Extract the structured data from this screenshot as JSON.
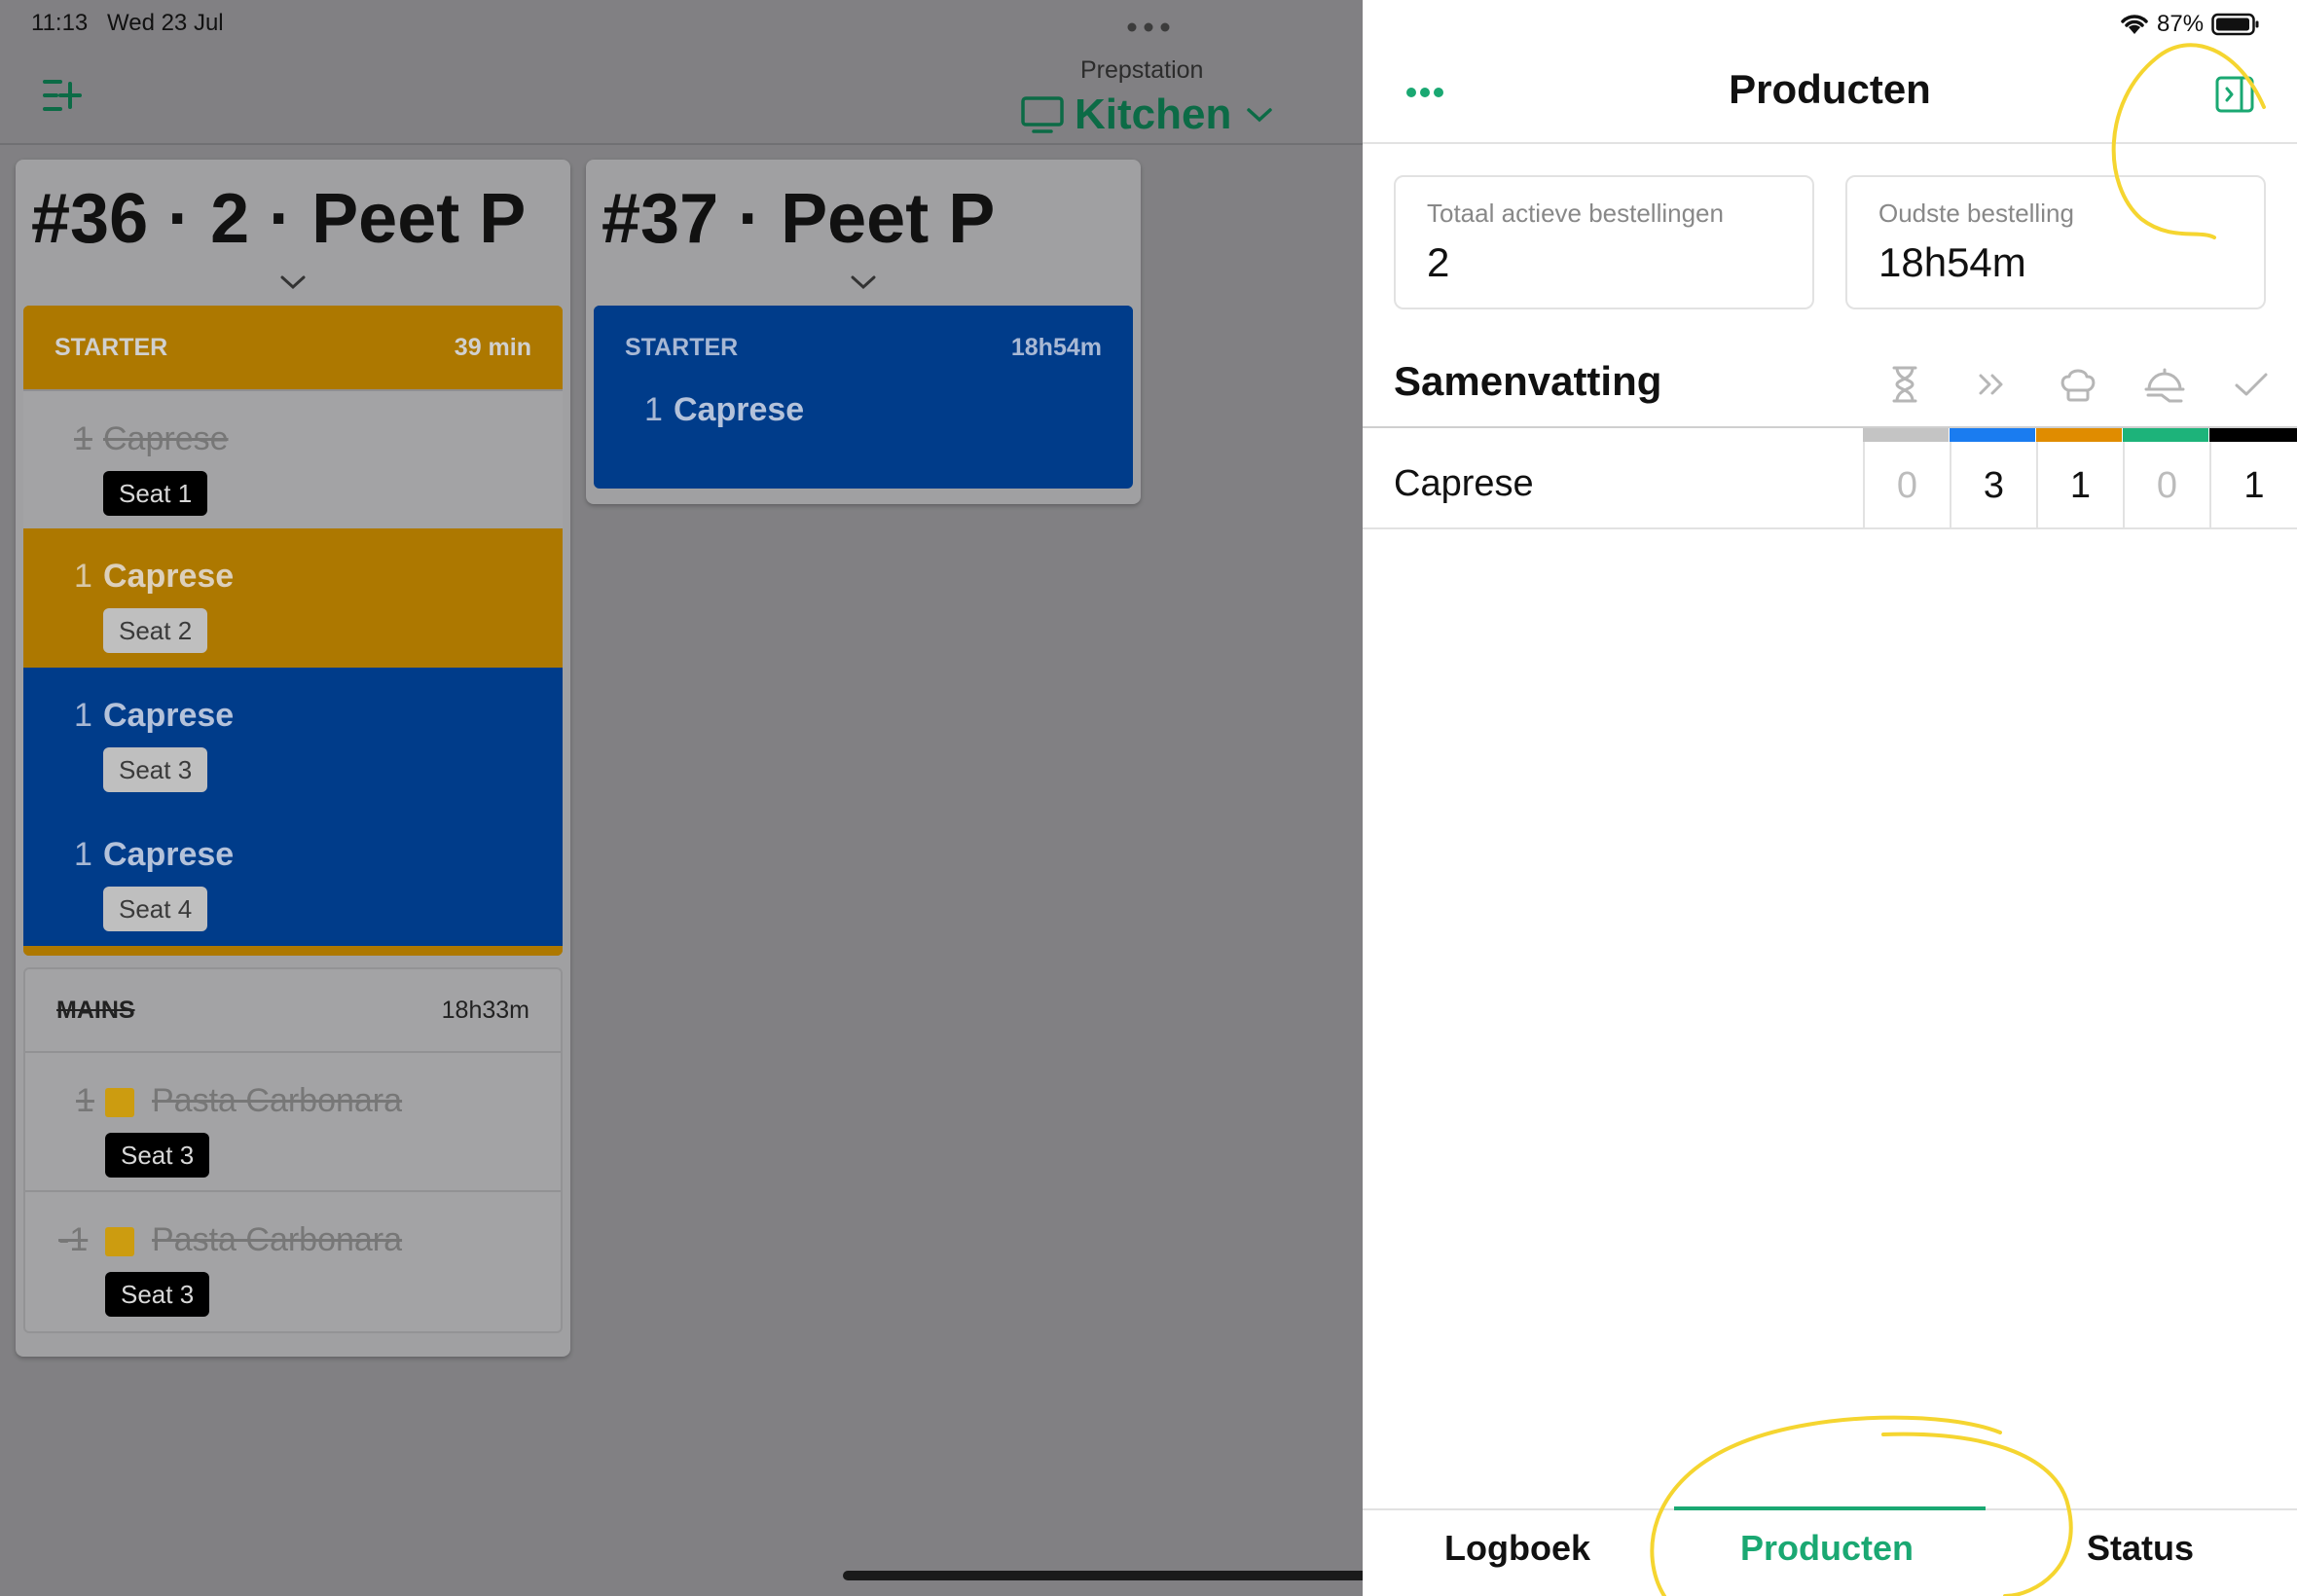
{
  "status_bar": {
    "time": "11:13",
    "date": "Wed 23 Jul",
    "battery": "87%"
  },
  "header": {
    "prepstation_label": "Prepstation",
    "station_name": "Kitchen"
  },
  "orders": [
    {
      "title": "#36 · 2 · Peet P",
      "starter": {
        "label": "STARTER",
        "time": "39 min"
      },
      "starter_items": [
        {
          "qty": "1",
          "name": "Caprese",
          "seat": "Seat 1"
        },
        {
          "qty": "1",
          "name": "Caprese",
          "seat": "Seat 2"
        },
        {
          "qty": "1",
          "name": "Caprese",
          "seat": "Seat 3"
        },
        {
          "qty": "1",
          "name": "Caprese",
          "seat": "Seat 4"
        }
      ],
      "mains": {
        "label": "MAINS",
        "time": "18h33m"
      },
      "mains_items": [
        {
          "qty": "1",
          "name": "Pasta Carbonara",
          "seat": "Seat 3"
        },
        {
          "qty": "-1",
          "name": "Pasta Carbonara",
          "seat": "Seat 3"
        }
      ]
    },
    {
      "title": "#37 · Peet P",
      "starter": {
        "label": "STARTER",
        "time": "18h54m"
      },
      "starter_items": [
        {
          "qty": "1",
          "name": "Caprese"
        }
      ]
    }
  ],
  "panel": {
    "title": "Producten",
    "stats": [
      {
        "label": "Totaal actieve bestellingen",
        "value": "2"
      },
      {
        "label": "Oudste bestelling",
        "value": "18h54m"
      }
    ],
    "summary_title": "Samenvatting",
    "column_icons": [
      "hourglass-icon",
      "forward-icon",
      "chef-hat-icon",
      "serving-cloche-icon",
      "checkmark-icon"
    ],
    "column_colors": [
      "#c4c4c4",
      "#1a7cf0",
      "#e08c00",
      "#1db37a",
      "#000000"
    ],
    "rows": [
      {
        "name": "Caprese",
        "counts": [
          "0",
          "3",
          "1",
          "0",
          "1"
        ]
      }
    ]
  },
  "tabs": [
    {
      "label": "Logboek",
      "active": false
    },
    {
      "label": "Producten",
      "active": true
    },
    {
      "label": "Status",
      "active": false
    }
  ],
  "colors": {
    "accent": "#1aa872",
    "orange": "#ad7800",
    "blue": "#003c8a"
  }
}
